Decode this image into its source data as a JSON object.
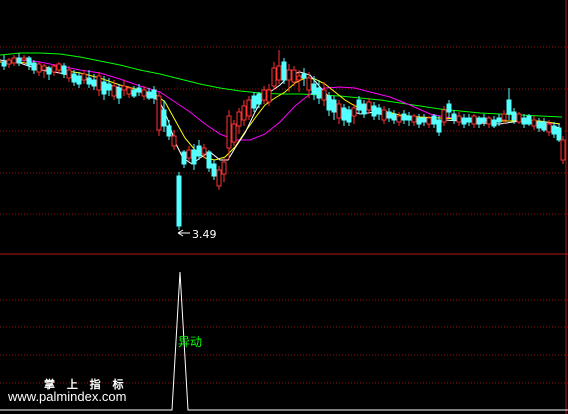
{
  "colors": {
    "background": "#000000",
    "grid": "#8b1010",
    "up_candle": "#ff3232",
    "down_candle": "#54ffff",
    "ma_short": "#ffffff",
    "ma_mid": "#ffff00",
    "ma_long1": "#ff00ff",
    "ma_long2": "#00ff00",
    "signal": "#ffffff",
    "signal_label": "#00ff00"
  },
  "main_panel": {
    "low_label": "3.49"
  },
  "sub_panel": {
    "signal_label": "异动"
  },
  "watermark": {
    "line1": "掌 上 指 标",
    "line2": "www.palmindex.com"
  }
}
